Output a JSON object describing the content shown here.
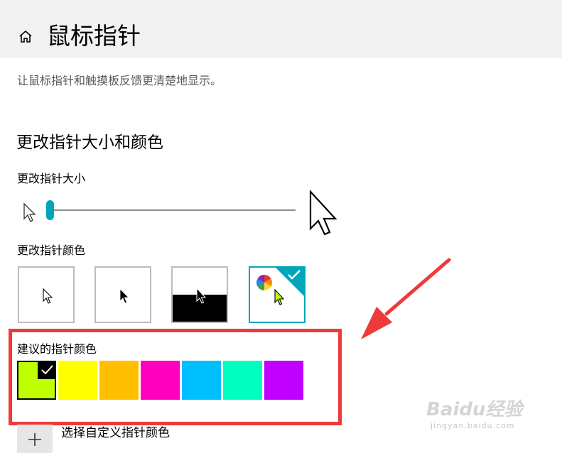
{
  "header": {
    "title": "鼠标指针",
    "home_icon": "home-icon"
  },
  "description": "让鼠标指针和触摸板反馈更清楚地显示。",
  "section": {
    "title": "更改指针大小和颜色",
    "size_label": "更改指针大小",
    "size_value": 1,
    "size_range": [
      1,
      15
    ],
    "color_label": "更改指针颜色",
    "color_options": [
      {
        "name": "white",
        "selected": false
      },
      {
        "name": "black",
        "selected": false
      },
      {
        "name": "inverted",
        "selected": false
      },
      {
        "name": "custom",
        "selected": true
      }
    ]
  },
  "suggested": {
    "label": "建议的指针颜色",
    "colors": [
      "#bfff00",
      "#ffff00",
      "#ffbf00",
      "#ff00bf",
      "#00bfff",
      "#00ffbf",
      "#bf00ff"
    ],
    "selected_index": 0
  },
  "custom": {
    "label": "选择自定义指针颜色",
    "icon": "plus-icon"
  },
  "accent": "#00a7bc",
  "watermark": {
    "text": "Baidu经验",
    "sub": "jingyan.baidu.com"
  }
}
